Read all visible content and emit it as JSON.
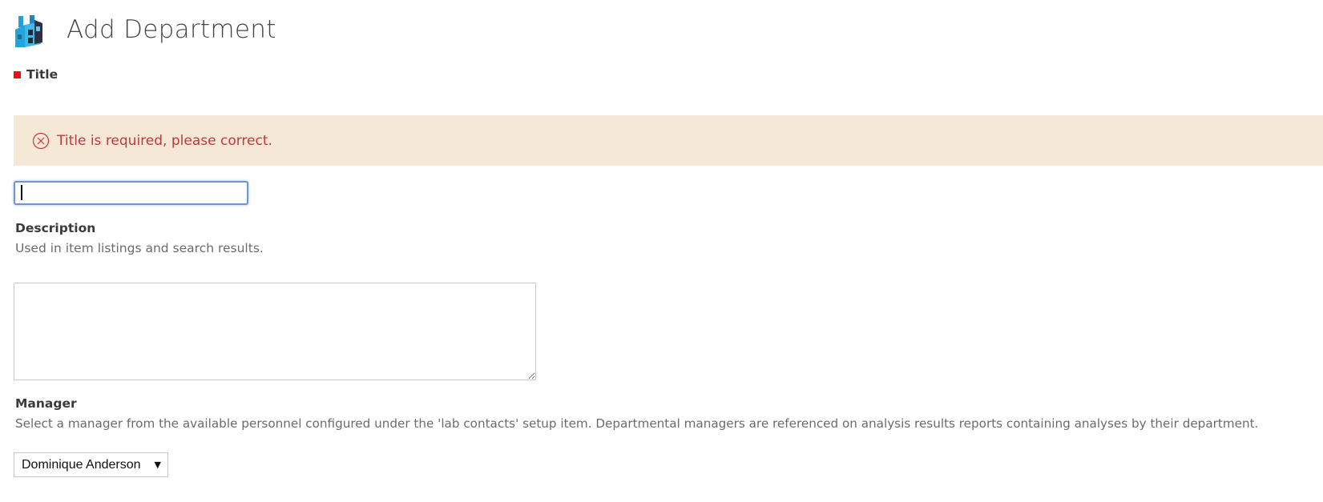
{
  "header": {
    "title": "Add Department",
    "icon": "department-factory-icon"
  },
  "form": {
    "title_field": {
      "label": "Title",
      "required": true,
      "value": "",
      "error_message": "Title is required, please correct."
    },
    "description_field": {
      "label": "Description",
      "help": "Used in item listings and search results.",
      "value": ""
    },
    "manager_field": {
      "label": "Manager",
      "help": "Select a manager from the available personnel configured under the 'lab contacts' setup item. Departmental managers are referenced on analysis results reports containing analyses by their department.",
      "selected": "Dominique Anderson"
    }
  },
  "colors": {
    "required_marker": "#ee1111",
    "error_background": "#f5e8d6",
    "error_text": "#c0393b",
    "focus_border": "#6e96d1"
  }
}
